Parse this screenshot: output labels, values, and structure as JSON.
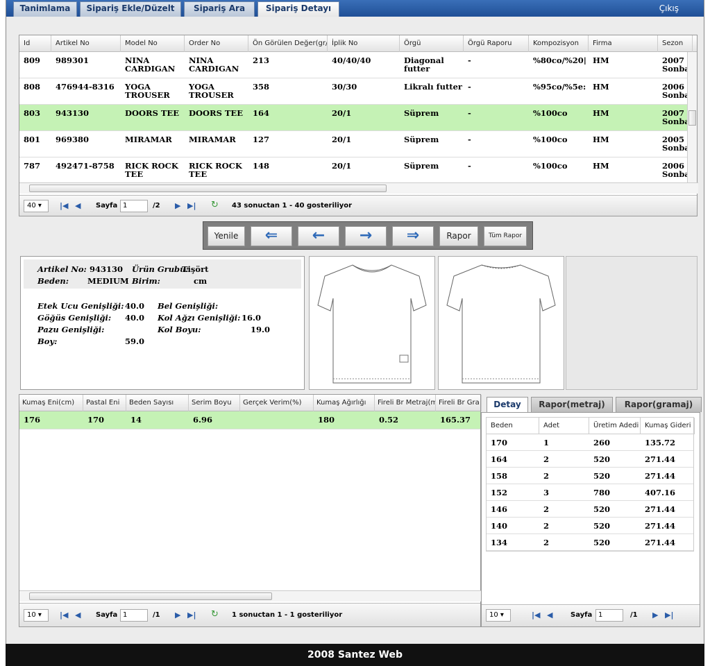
{
  "tabs": [
    "Tanimlama",
    "Sipariş Ekle/Düzelt",
    "Sipariş Ara",
    "Sipariş Detayı"
  ],
  "exit_label": "Çıkış",
  "main_grid": {
    "headers": [
      "Id",
      "Artikel No",
      "Model No",
      "Order No",
      "Ön Görülen Değer(gr/",
      "İplik No",
      "Örgü",
      "Örgü Raporu",
      "Kompozisyon",
      "Firma",
      "Sezon"
    ],
    "rows": [
      [
        "809",
        "989301",
        "NINA CARDIGAN",
        "NINA CARDIGAN",
        "213",
        "40/40/40",
        "Diagonal futter",
        "-",
        "%80co/%20|",
        "HM",
        "2007 Sonba"
      ],
      [
        "808",
        "476944-8316",
        "YOGA TROUSER",
        "YOGA TROUSER",
        "358",
        "30/30",
        "Likralı futter",
        "-",
        "%95co/%5e:",
        "HM",
        "2006 Sonba"
      ],
      [
        "803",
        "943130",
        "DOORS TEE",
        "DOORS TEE",
        "164",
        "20/1",
        "Süprem",
        "-",
        "%100co",
        "HM",
        "2007 Sonba"
      ],
      [
        "801",
        "969380",
        "MIRAMAR",
        "MIRAMAR",
        "127",
        "20/1",
        "Süprem",
        "-",
        "%100co",
        "HM",
        "2005 Sonba"
      ],
      [
        "787",
        "492471-8758",
        "RICK ROCK TEE",
        "RICK ROCK TEE",
        "148",
        "20/1",
        "Süprem",
        "-",
        "%100co",
        "HM",
        "2006 Sonba"
      ]
    ],
    "selected_index": 2,
    "pager": {
      "page_size": "40",
      "page_label": "Sayfa",
      "page": "1",
      "total_pages": "/2",
      "info": "43 sonuctan 1 - 40 gosteriliyor"
    }
  },
  "toolbar": {
    "refresh": "Yenile",
    "report": "Rapor",
    "all_report": "Tüm Rapor"
  },
  "info": {
    "artikel_label": "Artikel No:",
    "artikel_value": "943130",
    "urun_label": "Ürün Grubu:",
    "urun_value": "Tişört",
    "beden_label": "Beden:",
    "beden_value": "MEDIUM",
    "birim_label": "Birim:",
    "birim_value": "cm",
    "etek_label": "Etek Ucu Genişliği:",
    "etek_value": "40.0",
    "bel_label": "Bel Genişliği:",
    "bel_value": "",
    "gogus_label": "Göğüs Genişliği:",
    "gogus_value": "40.0",
    "kolagzi_label": "Kol Ağzı Genişliği:",
    "kolagzi_value": "16.0",
    "pazu_label": "Pazu Genişliği:",
    "pazu_value": "",
    "kolboyu_label": "Kol Boyu:",
    "kolboyu_value": "19.0",
    "boy_label": "Boy:",
    "boy_value": "59.0"
  },
  "fabric_grid": {
    "headers": [
      "Kumaş Eni(cm)",
      "Pastal Eni",
      "Beden Sayısı",
      "Serim Boyu",
      "Gerçek Verim(%)",
      "Kumaş Ağırlığı",
      "Fireli Br Metraj(m)",
      "Fireli Br Gra"
    ],
    "rows": [
      [
        "176",
        "170",
        "14",
        "6.96",
        "",
        "180",
        "0.52",
        "165.37"
      ]
    ],
    "pager": {
      "page_size": "10",
      "page_label": "Sayfa",
      "page": "1",
      "total_pages": "/1",
      "info": "1 sonuctan 1 - 1 gosteriliyor"
    }
  },
  "right_tabs": [
    "Detay",
    "Rapor(metraj)",
    "Rapor(gramaj)"
  ],
  "detail_grid": {
    "headers": [
      "Beden",
      "Adet",
      "Üretim Adedi",
      "Kumaş Gideri"
    ],
    "rows": [
      [
        "170",
        "1",
        "260",
        "135.72"
      ],
      [
        "164",
        "2",
        "520",
        "271.44"
      ],
      [
        "158",
        "2",
        "520",
        "271.44"
      ],
      [
        "152",
        "3",
        "780",
        "407.16"
      ],
      [
        "146",
        "2",
        "520",
        "271.44"
      ],
      [
        "140",
        "2",
        "520",
        "271.44"
      ],
      [
        "134",
        "2",
        "520",
        "271.44"
      ]
    ],
    "pager": {
      "page_size": "10",
      "page_label": "Sayfa",
      "page": "1",
      "total_pages": "/1"
    }
  },
  "footer": "2008 Santez Web",
  "colors": {
    "selected_row": "#c5f2b5",
    "topbar": "#2a5aa0",
    "footer": "#111111"
  }
}
